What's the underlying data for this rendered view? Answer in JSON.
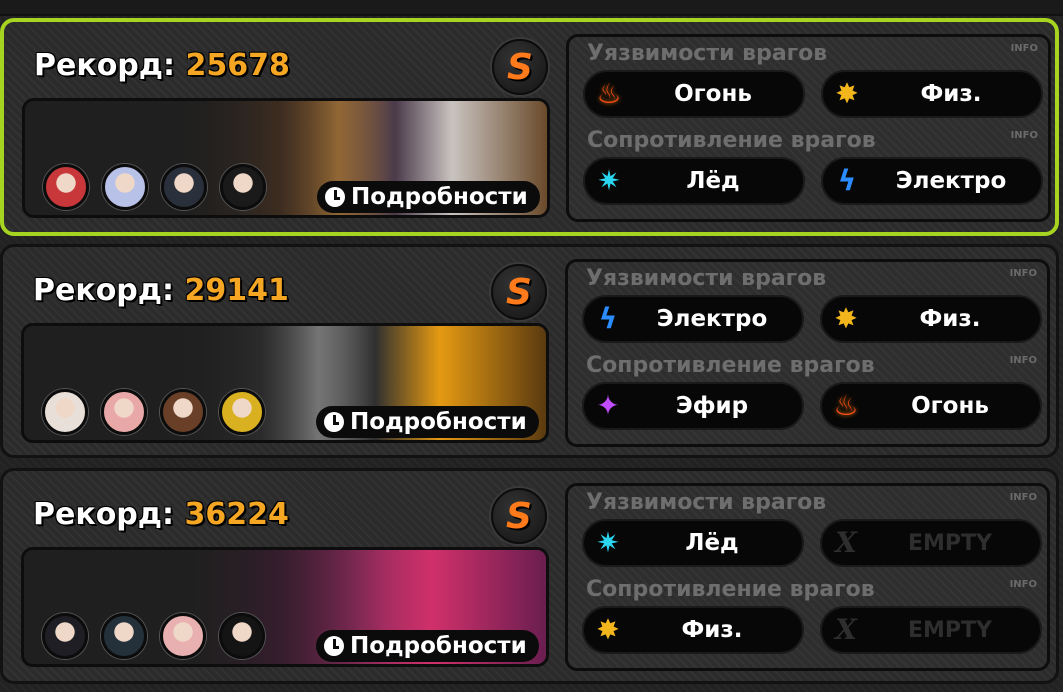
{
  "labels": {
    "record_prefix": "Рекорд:",
    "rank": "S",
    "details": "Подробности",
    "weakness_title": "Уязвимости врагов",
    "resistance_title": "Сопротивление врагов",
    "info": "INFO"
  },
  "colors": {
    "selected_border": "#a7d421",
    "score": "#f5a623",
    "rank": "#ff7a1a"
  },
  "cards": [
    {
      "score": "25678",
      "selected": true,
      "avatars": [
        "#c8383a",
        "#b8c2e8",
        "#2a2f3c",
        "#1a1a1a"
      ],
      "weaknesses": [
        {
          "icon": "fire-icon",
          "label": "Огонь"
        },
        {
          "icon": "physical-icon",
          "label": "Физ."
        }
      ],
      "resistances": [
        {
          "icon": "ice-icon",
          "label": "Лёд"
        },
        {
          "icon": "electric-icon",
          "label": "Электро"
        }
      ]
    },
    {
      "score": "29141",
      "selected": false,
      "avatars": [
        "#e8e0d8",
        "#e8a8a8",
        "#6a3f28",
        "#d8b020"
      ],
      "weaknesses": [
        {
          "icon": "electric-icon",
          "label": "Электро"
        },
        {
          "icon": "physical-icon",
          "label": "Физ."
        }
      ],
      "resistances": [
        {
          "icon": "ether-icon",
          "label": "Эфир"
        },
        {
          "icon": "fire-icon",
          "label": "Огонь"
        }
      ]
    },
    {
      "score": "36224",
      "selected": false,
      "avatars": [
        "#1e1e24",
        "#24303a",
        "#e8b0b0",
        "#141414"
      ],
      "weaknesses": [
        {
          "icon": "ice-icon",
          "label": "Лёд"
        },
        {
          "icon": "empty-x-icon",
          "label": "EMPTY"
        }
      ],
      "resistances": [
        {
          "icon": "physical-icon",
          "label": "Физ."
        },
        {
          "icon": "empty-x-icon",
          "label": "EMPTY"
        }
      ]
    }
  ]
}
